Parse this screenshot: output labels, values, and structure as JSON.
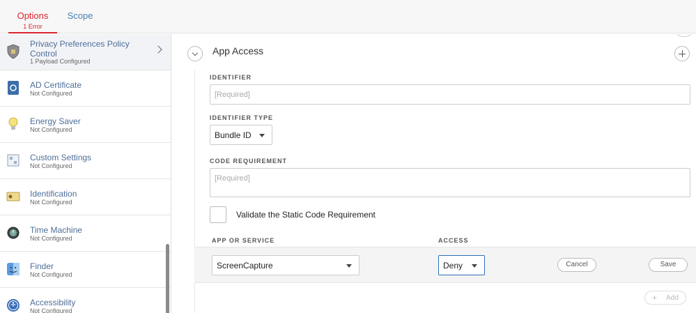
{
  "tabs": {
    "options_label": "Options",
    "options_error": "1 Error",
    "scope_label": "Scope"
  },
  "sidebar": {
    "items": [
      {
        "title": "Privacy Preferences Policy Control",
        "sub": "1 Payload Configured",
        "icon": "shield-icon"
      },
      {
        "title": "AD Certificate",
        "sub": "Not Configured",
        "icon": "certificate-icon"
      },
      {
        "title": "Energy Saver",
        "sub": "Not Configured",
        "icon": "lightbulb-icon"
      },
      {
        "title": "Custom Settings",
        "sub": "Not Configured",
        "icon": "custom-settings-icon"
      },
      {
        "title": "Identification",
        "sub": "Not Configured",
        "icon": "id-card-icon"
      },
      {
        "title": "Time Machine",
        "sub": "Not Configured",
        "icon": "time-machine-icon"
      },
      {
        "title": "Finder",
        "sub": "Not Configured",
        "icon": "finder-icon"
      },
      {
        "title": "Accessibility",
        "sub": "Not Configured",
        "icon": "accessibility-icon"
      }
    ]
  },
  "main": {
    "section_title": "App Access",
    "identifier_label": "IDENTIFIER",
    "identifier_placeholder": "[Required]",
    "identifier_type_label": "IDENTIFIER TYPE",
    "identifier_type_value": "Bundle ID",
    "code_requirement_label": "CODE REQUIREMENT",
    "code_requirement_placeholder": "[Required]",
    "validate_label": "Validate the Static Code Requirement",
    "app_or_service_header": "APP OR SERVICE",
    "access_header": "ACCESS",
    "app_value": "ScreenCapture",
    "access_value": "Deny",
    "cancel_label": "Cancel",
    "save_label": "Save",
    "add_label": "Add",
    "add_plus": "+"
  },
  "colors": {
    "accent_error": "#d9242e",
    "link_blue": "#4d6e99",
    "focus_blue": "#2e6fb5"
  }
}
